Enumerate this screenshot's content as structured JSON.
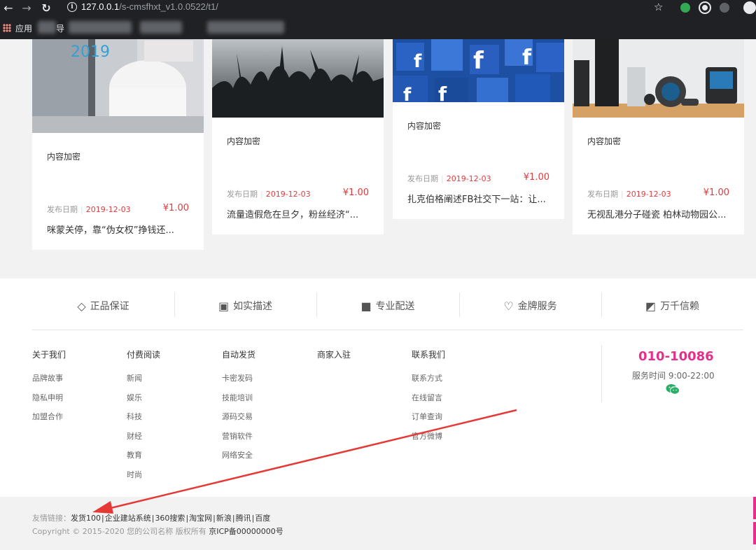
{
  "browser": {
    "url_host": "127.0.0.1",
    "url_path": "/s-cmsfhxt_v1.0.0522/t1/",
    "bookmarks_label": "应用",
    "bookmark_text": "导"
  },
  "cards": [
    {
      "title": "内容加密",
      "meta_label": "发布日期",
      "date": "2019-12-03",
      "price": "¥1.00",
      "desc": "咪蒙关停，靠“伪女权”挣钱还..."
    },
    {
      "title": "内容加密",
      "meta_label": "发布日期",
      "date": "2019-12-03",
      "price": "¥1.00",
      "desc": "流量造假危在旦夕，粉丝经济“..."
    },
    {
      "title": "内容加密",
      "meta_label": "发布日期",
      "date": "2019-12-03",
      "price": "¥1.00",
      "desc": "扎克伯格阐述FB社交下一站：让..."
    },
    {
      "title": "内容加密",
      "meta_label": "发布日期",
      "date": "2019-12-03",
      "price": "¥1.00",
      "desc": "无视乱港分子碰瓷 柏林动物园公..."
    }
  ],
  "guarantees": [
    {
      "label": "正品保证",
      "icon": "diamond-icon"
    },
    {
      "label": "如实描述",
      "icon": "camera-icon"
    },
    {
      "label": "专业配送",
      "icon": "truck-icon"
    },
    {
      "label": "金牌服务",
      "icon": "heart-icon"
    },
    {
      "label": "万千信赖",
      "icon": "picture-icon"
    }
  ],
  "footer_cols": [
    {
      "title": "关于我们",
      "items": [
        "品牌故事",
        "隐私申明",
        "加盟合作"
      ]
    },
    {
      "title": "付费阅读",
      "items": [
        "新闻",
        "娱乐",
        "科技",
        "财经",
        "教育",
        "时尚"
      ]
    },
    {
      "title": "自动发货",
      "items": [
        "卡密发码",
        "技能培训",
        "源码交易",
        "营销软件",
        "网络安全"
      ]
    },
    {
      "title": "商家入驻",
      "items": []
    },
    {
      "title": "联系我们",
      "items": [
        "联系方式",
        "在线留言",
        "订单查询",
        "官方微博"
      ]
    }
  ],
  "contact": {
    "phone": "010-10086",
    "hours": "服务时间 9:00-22:00",
    "wechat_icon": "wechat-icon"
  },
  "links": {
    "label": "友情链接：",
    "items": [
      "发货100",
      "企业建站系统",
      "360搜索",
      "淘宝网",
      "新浪",
      "腾讯",
      "百度"
    ]
  },
  "copyright": {
    "text": "Copyright © 2015-2020 您的公司名称 版权所有",
    "icp": "京ICP备00000000号"
  },
  "colors": {
    "accent": "#e4308a",
    "price": "#e4393c",
    "annotation_arrow": "#e53935"
  }
}
